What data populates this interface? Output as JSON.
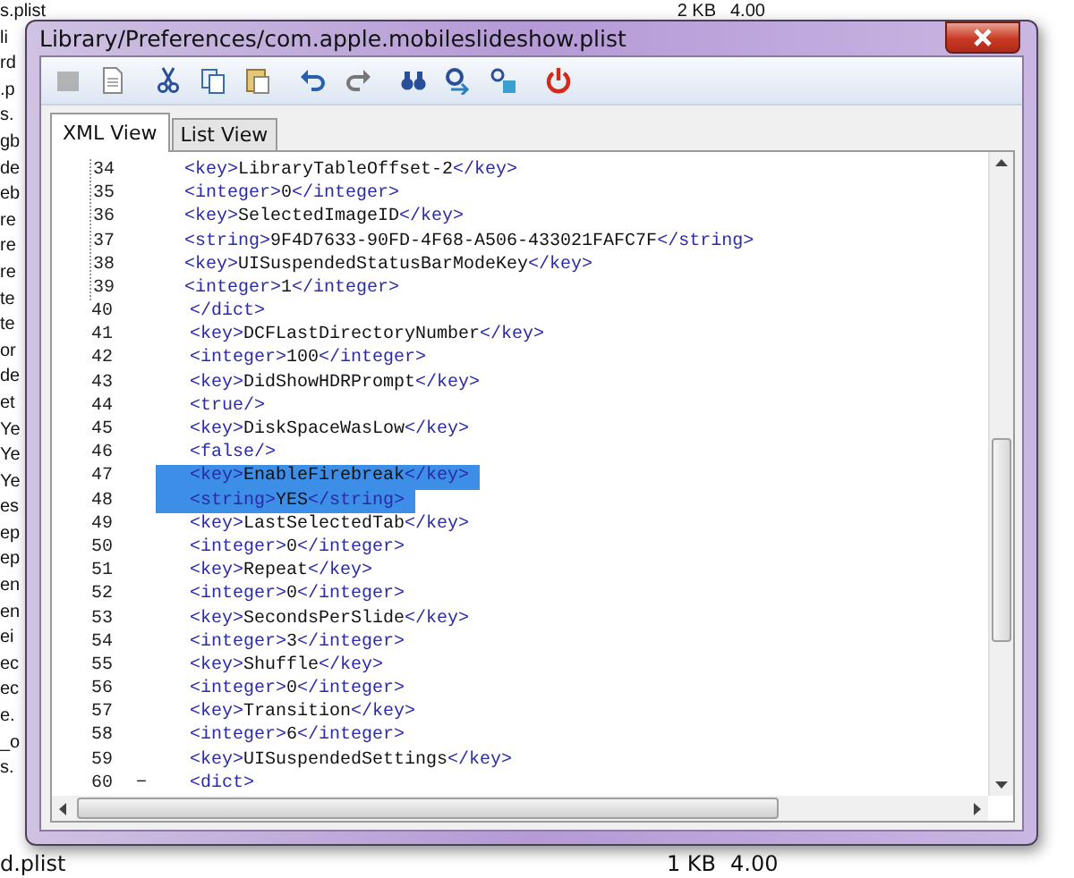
{
  "file_list": {
    "rows": [
      {
        "name": "s.plist",
        "size": "2 KB",
        "date": "4.00"
      },
      {
        "name": "li"
      },
      {
        "name": "rd"
      },
      {
        "name": ".p"
      },
      {
        "name": "s."
      },
      {
        "name": "gb"
      },
      {
        "name": "de"
      },
      {
        "name": "eb"
      },
      {
        "name": "re"
      },
      {
        "name": "re"
      },
      {
        "name": "re"
      },
      {
        "name": "te"
      },
      {
        "name": "te"
      },
      {
        "name": "or"
      },
      {
        "name": "de"
      },
      {
        "name": "et"
      },
      {
        "name": "Ye"
      },
      {
        "name": "Ye"
      },
      {
        "name": "Ye"
      },
      {
        "name": "es"
      },
      {
        "name": "ep"
      },
      {
        "name": "ep"
      },
      {
        "name": "en"
      },
      {
        "name": "en"
      },
      {
        "name": "ei"
      },
      {
        "name": "ec"
      },
      {
        "name": "ec"
      },
      {
        "name": "e."
      },
      {
        "name": "_o"
      },
      {
        "name": "s."
      }
    ],
    "last_row": {
      "name": "d.plist",
      "size": "1 KB",
      "date": "4.00"
    }
  },
  "window": {
    "title": "Library/Preferences/com.apple.mobileslideshow.plist"
  },
  "toolbar": [
    {
      "kind": "stop",
      "disabled": true
    },
    {
      "kind": "new",
      "disabled": false
    },
    {
      "kind": "cut",
      "disabled": false
    },
    {
      "kind": "copy",
      "disabled": false
    },
    {
      "kind": "paste",
      "disabled": false
    },
    {
      "kind": "undo",
      "disabled": false
    },
    {
      "kind": "redo",
      "disabled": false
    },
    {
      "kind": "find",
      "disabled": false
    },
    {
      "kind": "find-next",
      "disabled": false
    },
    {
      "kind": "replace",
      "disabled": false
    },
    {
      "kind": "power",
      "disabled": false
    }
  ],
  "tabs": [
    {
      "label": "XML View",
      "selected": true
    },
    {
      "label": "List View",
      "selected": false
    }
  ],
  "editor": {
    "lines": [
      {
        "kind": "nested",
        "children": [
          {
            "number": "34",
            "text": "<key>LibraryTableOffset-2</key>",
            "selected": false
          },
          {
            "number": "35",
            "text": "<integer>0</integer>",
            "selected": false
          },
          {
            "number": "36",
            "text": "<key>SelectedImageID</key>",
            "selected": false
          },
          {
            "number": "37",
            "text": "<string>9F4D7633-90FD-4F68-A506-433021FAFC7F</string>",
            "selected": false
          },
          {
            "number": "38",
            "text": "<key>UISuspendedStatusBarModeKey</key>",
            "selected": false
          },
          {
            "number": "39",
            "text": "<integer>1</integer>",
            "selected": false
          }
        ]
      },
      {
        "kind": "line",
        "number": "40",
        "text": "</dict>",
        "selected": false
      },
      {
        "kind": "line",
        "number": "41",
        "text": "<key>DCFLastDirectoryNumber</key>",
        "selected": false
      },
      {
        "kind": "line",
        "number": "42",
        "text": "<integer>100</integer>",
        "selected": false
      },
      {
        "kind": "line",
        "number": "43",
        "text": "<key>DidShowHDRPrompt</key>",
        "selected": false
      },
      {
        "kind": "line",
        "number": "44",
        "text": "<true/>",
        "selected": false
      },
      {
        "kind": "line",
        "number": "45",
        "text": "<key>DiskSpaceWasLow</key>",
        "selected": false
      },
      {
        "kind": "line",
        "number": "46",
        "text": "<false/>",
        "selected": false
      },
      {
        "kind": "line",
        "number": "47",
        "text": "<key>EnableFirebreak</key>",
        "selected": true
      },
      {
        "kind": "line",
        "number": "48",
        "text": "<string>YES</string>",
        "selected": true
      },
      {
        "kind": "line",
        "number": "49",
        "text": "<key>LastSelectedTab</key>",
        "selected": false
      },
      {
        "kind": "line",
        "number": "50",
        "text": "<integer>0</integer>",
        "selected": false
      },
      {
        "kind": "line",
        "number": "51",
        "text": "<key>Repeat</key>",
        "selected": false
      },
      {
        "kind": "line",
        "number": "52",
        "text": "<integer>0</integer>",
        "selected": false
      },
      {
        "kind": "line",
        "number": "53",
        "text": "<key>SecondsPerSlide</key>",
        "selected": false
      },
      {
        "kind": "line",
        "number": "54",
        "text": "<integer>3</integer>",
        "selected": false
      },
      {
        "kind": "line",
        "number": "55",
        "text": "<key>Shuffle</key>",
        "selected": false
      },
      {
        "kind": "line",
        "number": "56",
        "text": "<integer>0</integer>",
        "selected": false
      },
      {
        "kind": "line",
        "number": "57",
        "text": "<key>Transition</key>",
        "selected": false
      },
      {
        "kind": "line",
        "number": "58",
        "text": "<integer>6</integer>",
        "selected": false
      },
      {
        "kind": "line",
        "number": "59",
        "text": "<key>UISuspendedSettings</key>",
        "selected": false
      },
      {
        "kind": "line",
        "number": "60",
        "text": "<dict>",
        "selected": false,
        "fold_marker": "−"
      }
    ]
  }
}
